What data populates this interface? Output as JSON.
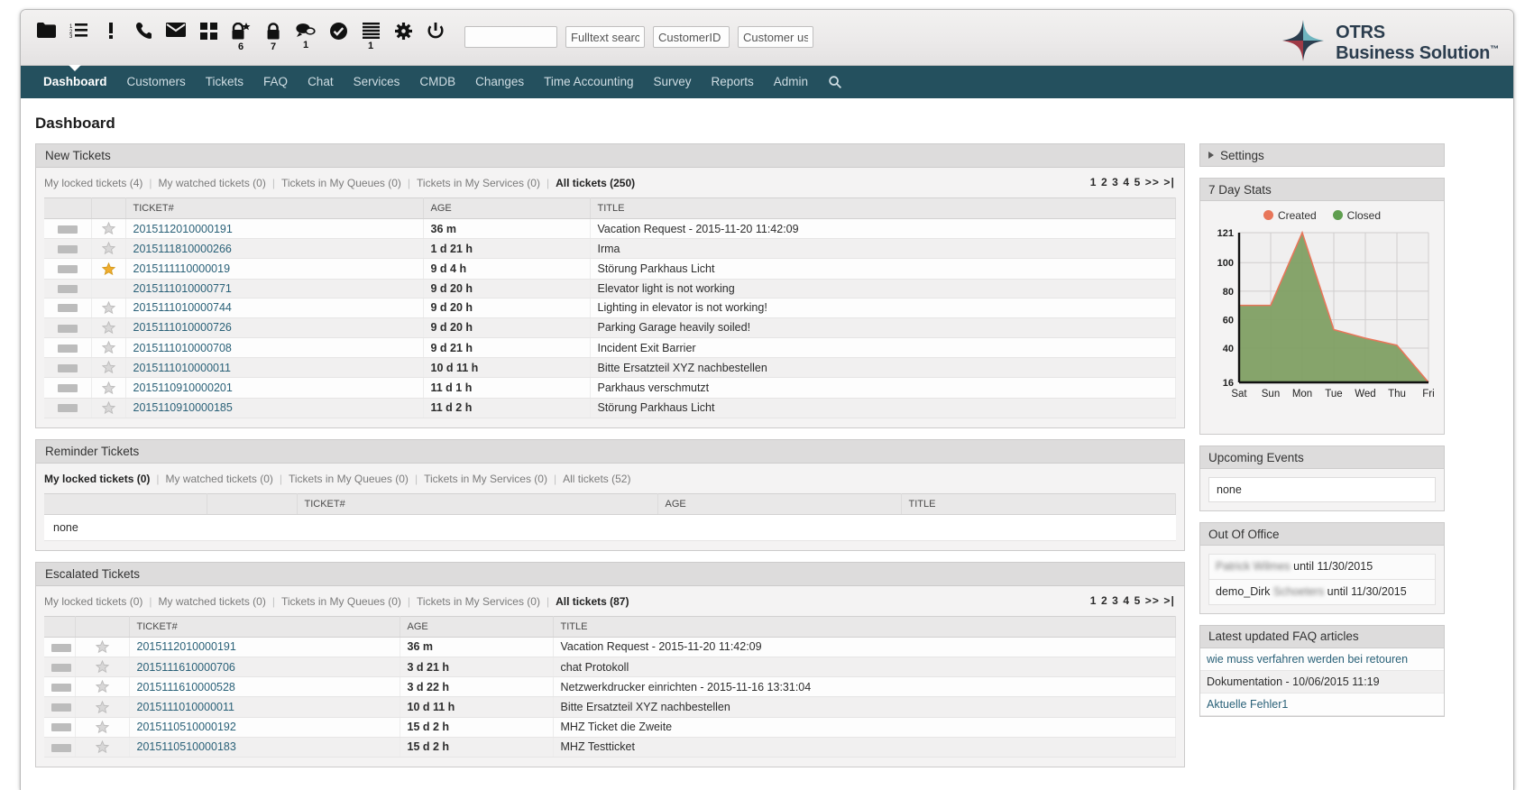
{
  "toolbar": {
    "icons": [
      {
        "name": "folder-icon",
        "badge": ""
      },
      {
        "name": "numbered-list-icon",
        "badge": ""
      },
      {
        "name": "exclamation-icon",
        "badge": ""
      },
      {
        "name": "phone-icon",
        "badge": ""
      },
      {
        "name": "envelope-icon",
        "badge": ""
      },
      {
        "name": "grid-icon",
        "badge": ""
      },
      {
        "name": "lock-star-icon",
        "badge": "6"
      },
      {
        "name": "lock-icon",
        "badge": "7"
      },
      {
        "name": "chat-icon",
        "badge": "1"
      },
      {
        "name": "check-circle-icon",
        "badge": ""
      },
      {
        "name": "list-icon",
        "badge": "1"
      },
      {
        "name": "gear-icon",
        "badge": ""
      },
      {
        "name": "power-icon",
        "badge": ""
      }
    ],
    "search_blank_value": "",
    "search_blank_placeholder": "",
    "fulltext_value": "Fulltext search",
    "customerid_value": "CustomerID search",
    "customeruser_value": "Customer user search"
  },
  "brand": {
    "line1": "OTRS",
    "line2": "Business Solution",
    "tm": "™",
    "logo_icon": "otrs-star-logo"
  },
  "nav": {
    "items": [
      {
        "label": "Dashboard",
        "active": true
      },
      {
        "label": "Customers",
        "active": false
      },
      {
        "label": "Tickets",
        "active": false
      },
      {
        "label": "FAQ",
        "active": false
      },
      {
        "label": "Chat",
        "active": false
      },
      {
        "label": "Services",
        "active": false
      },
      {
        "label": "CMDB",
        "active": false
      },
      {
        "label": "Changes",
        "active": false
      },
      {
        "label": "Time Accounting",
        "active": false
      },
      {
        "label": "Survey",
        "active": false
      },
      {
        "label": "Reports",
        "active": false
      },
      {
        "label": "Admin",
        "active": false
      }
    ],
    "search_icon": "search-icon"
  },
  "page": {
    "title": "Dashboard"
  },
  "new_tickets": {
    "heading": "New Tickets",
    "filters": [
      {
        "label": "My locked tickets (4)",
        "selected": false
      },
      {
        "label": "My watched tickets (0)",
        "selected": false
      },
      {
        "label": "Tickets in My Queues (0)",
        "selected": false
      },
      {
        "label": "Tickets in My Services (0)",
        "selected": false
      },
      {
        "label": "All tickets (250)",
        "selected": true
      }
    ],
    "pager": "1 2 3 4 5 >> >|",
    "columns": [
      "",
      "",
      "TICKET#",
      "AGE",
      "TITLE"
    ],
    "rows": [
      {
        "ticket": "2015112010000191",
        "age": "36 m",
        "title": "Vacation Request - 2015-11-20 11:42:09",
        "star": "empty"
      },
      {
        "ticket": "2015111810000266",
        "age": "1 d 21 h",
        "title": "Irma",
        "star": "empty"
      },
      {
        "ticket": "2015111110000019",
        "age": "9 d 4 h",
        "title": "Störung Parkhaus Licht",
        "star": "filled"
      },
      {
        "ticket": "2015111010000771",
        "age": "9 d 20 h",
        "title": "Elevator light is not working",
        "star": "none"
      },
      {
        "ticket": "2015111010000744",
        "age": "9 d 20 h",
        "title": "Lighting in elevator is not working!",
        "star": "empty"
      },
      {
        "ticket": "2015111010000726",
        "age": "9 d 20 h",
        "title": "Parking Garage heavily soiled!",
        "star": "empty"
      },
      {
        "ticket": "2015111010000708",
        "age": "9 d 21 h",
        "title": "Incident Exit Barrier",
        "star": "empty"
      },
      {
        "ticket": "2015111010000011",
        "age": "10 d 11 h",
        "title": "Bitte Ersatzteil XYZ nachbestellen",
        "star": "empty"
      },
      {
        "ticket": "2015110910000201",
        "age": "11 d 1 h",
        "title": "Parkhaus verschmutzt",
        "star": "empty"
      },
      {
        "ticket": "2015110910000185",
        "age": "11 d 2 h",
        "title": "Störung Parkhaus Licht",
        "star": "empty"
      }
    ]
  },
  "reminder_tickets": {
    "heading": "Reminder Tickets",
    "filters": [
      {
        "label": "My locked tickets (0)",
        "selected": true
      },
      {
        "label": "My watched tickets (0)",
        "selected": false
      },
      {
        "label": "Tickets in My Queues (0)",
        "selected": false
      },
      {
        "label": "Tickets in My Services (0)",
        "selected": false
      },
      {
        "label": "All tickets (52)",
        "selected": false
      }
    ],
    "columns": [
      "",
      "",
      "TICKET#",
      "AGE",
      "TITLE"
    ],
    "empty_text": "none"
  },
  "escalated_tickets": {
    "heading": "Escalated Tickets",
    "filters": [
      {
        "label": "My locked tickets (0)",
        "selected": false
      },
      {
        "label": "My watched tickets (0)",
        "selected": false
      },
      {
        "label": "Tickets in My Queues (0)",
        "selected": false
      },
      {
        "label": "Tickets in My Services (0)",
        "selected": false
      },
      {
        "label": "All tickets (87)",
        "selected": true
      }
    ],
    "pager": "1 2 3 4 5 >> >|",
    "columns": [
      "",
      "",
      "TICKET#",
      "AGE",
      "TITLE"
    ],
    "rows": [
      {
        "ticket": "2015112010000191",
        "age": "36 m",
        "title": "Vacation Request - 2015-11-20 11:42:09",
        "star": "empty"
      },
      {
        "ticket": "2015111610000706",
        "age": "3 d 21 h",
        "title": "chat Protokoll",
        "star": "empty"
      },
      {
        "ticket": "2015111610000528",
        "age": "3 d 22 h",
        "title": "Netzwerkdrucker einrichten - 2015-11-16 13:31:04",
        "star": "empty"
      },
      {
        "ticket": "2015111010000011",
        "age": "10 d 11 h",
        "title": "Bitte Ersatzteil XYZ nachbestellen",
        "star": "empty"
      },
      {
        "ticket": "2015110510000192",
        "age": "15 d 2 h",
        "title": "MHZ Ticket die Zweite",
        "star": "empty"
      },
      {
        "ticket": "2015110510000183",
        "age": "15 d 2 h",
        "title": "MHZ Testticket",
        "star": "empty"
      }
    ]
  },
  "sidebar": {
    "settings": {
      "label": "Settings"
    },
    "seven_day_stats": {
      "heading": "7 Day Stats"
    },
    "upcoming_events": {
      "heading": "Upcoming Events",
      "empty_text": "none"
    },
    "out_of_office": {
      "heading": "Out Of Office",
      "entries": [
        {
          "name": "Patrick Wilmes",
          "blurred": true,
          "suffix": " until 11/30/2015"
        },
        {
          "name_prefix": "demo_Dirk ",
          "name": "Schoeters",
          "blurred": true,
          "suffix": " until 11/30/2015"
        }
      ]
    },
    "faq": {
      "heading": "Latest updated FAQ articles",
      "items": [
        {
          "text": "wie muss verfahren werden bei retouren",
          "link": true
        },
        {
          "text": "Dokumentation - 10/06/2015 11:19",
          "link": false
        },
        {
          "text": "Aktuelle Fehler1",
          "link": true
        }
      ]
    }
  },
  "chart_data": {
    "type": "area",
    "title": "7 Day Stats",
    "categories": [
      "Sat",
      "Sun",
      "Mon",
      "Tue",
      "Wed",
      "Thu",
      "Fri"
    ],
    "series": [
      {
        "name": "Created",
        "color": "#e8765a",
        "values": [
          70,
          70,
          121,
          53,
          47,
          42,
          16
        ]
      },
      {
        "name": "Closed",
        "color": "#7a9a5f",
        "values": [
          70,
          70,
          121,
          53,
          47,
          42,
          16
        ]
      }
    ],
    "ytick_labels": [
      "16",
      "40",
      "60",
      "80",
      "100",
      "121"
    ],
    "ylim": [
      16,
      121
    ],
    "xlabel": "",
    "ylabel": "",
    "grid": true,
    "legend_position": "top-center",
    "legend": [
      {
        "label": "Created",
        "color": "#e8765a"
      },
      {
        "label": "Closed",
        "color": "#5f9e4f"
      }
    ]
  },
  "colors": {
    "nav_bg": "#24505e",
    "link": "#2a6178",
    "widget_header": "#dddcdc",
    "star_filled": "#f0ad2e",
    "created": "#e8765a",
    "closed": "#5f9e4f",
    "area_fill": "#7f9f63"
  }
}
